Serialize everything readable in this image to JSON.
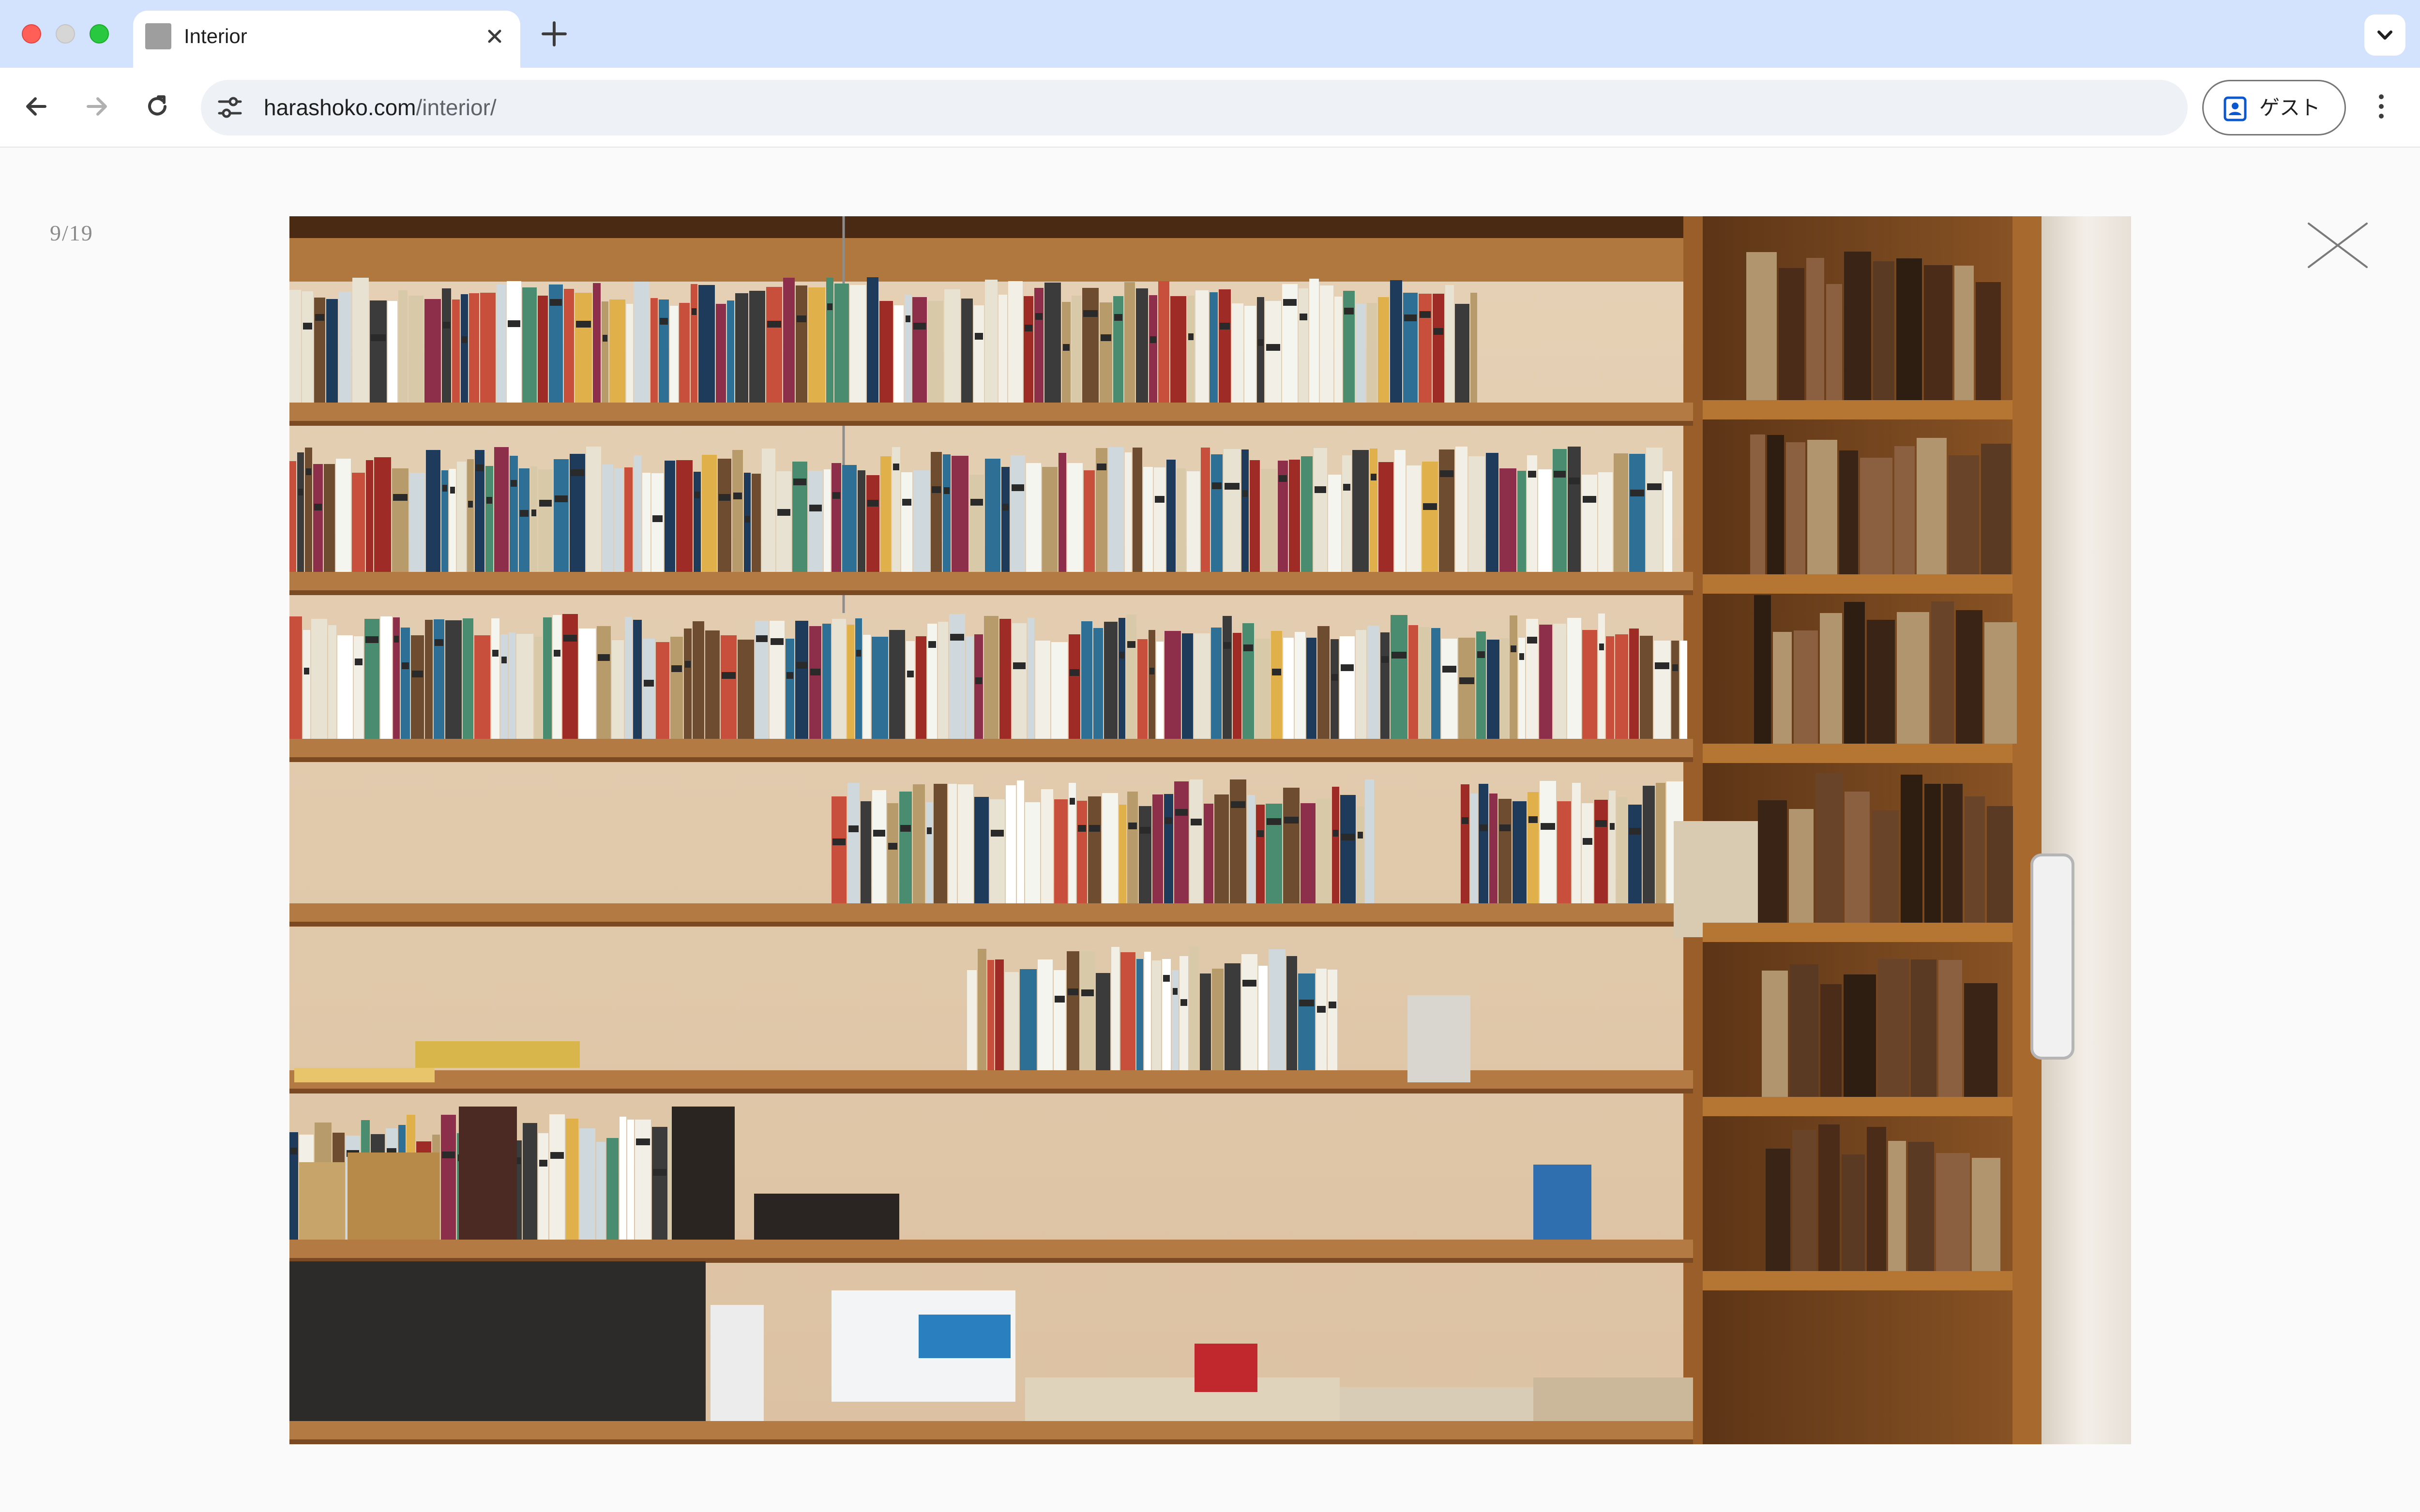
{
  "browser": {
    "tab": {
      "title": "Interior",
      "favicon_icon": "gray-square-favicon",
      "close_icon": "close-icon"
    },
    "new_tab_icon": "plus-icon",
    "tab_list_icon": "chevron-down-icon",
    "nav": {
      "back_icon": "arrow-left-icon",
      "forward_icon": "arrow-right-icon",
      "reload_icon": "reload-icon"
    },
    "address_bar": {
      "site_info_icon": "tune-icon",
      "url_host": "harashoko.com",
      "url_path": "/interior/"
    },
    "profile_button": {
      "label": "ゲスト",
      "icon": "guest-profile-icon"
    },
    "menu_icon": "kebab-menu-icon"
  },
  "lightbox": {
    "counter": "9/19",
    "close_icon": "close-x-icon",
    "image": {
      "subject": "wooden bookshelf photo",
      "colors": {
        "wall": "#e9d5bc",
        "shelf": "#a86a35",
        "cabinet": "#7a4a22",
        "door": "#ece7df"
      }
    }
  }
}
